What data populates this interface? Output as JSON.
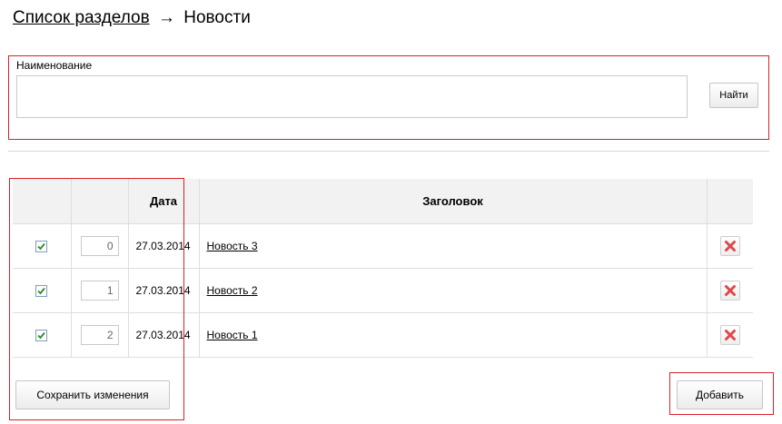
{
  "breadcrumb": {
    "parent_label": "Список разделов",
    "arrow": "→",
    "current_label": "Новости"
  },
  "search": {
    "label": "Наименование",
    "value": "",
    "button_label": "Найти"
  },
  "table": {
    "columns": [
      "",
      "",
      "Дата",
      "Заголовок",
      ""
    ],
    "rows": [
      {
        "checked": true,
        "order": "0",
        "date": "27.03.2014",
        "title": "Новость 3",
        "delete_icon": "red-x-icon"
      },
      {
        "checked": true,
        "order": "1",
        "date": "27.03.2014",
        "title": "Новость 2",
        "delete_icon": "red-x-icon"
      },
      {
        "checked": true,
        "order": "2",
        "date": "27.03.2014",
        "title": "Новость 1",
        "delete_icon": "red-x-icon"
      }
    ]
  },
  "actions": {
    "save_label": "Сохранить изменения",
    "add_label": "Добавить"
  },
  "colors": {
    "highlight_frame": "#d7202a",
    "header_bg": "#f2f2f2",
    "checkmark": "#2a8a2a",
    "delete_x": "#e0474c"
  }
}
